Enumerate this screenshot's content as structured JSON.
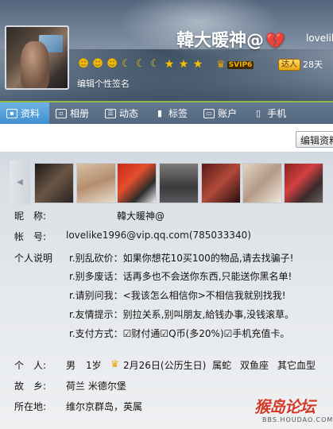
{
  "header": {
    "nickname": "韓大暖神@",
    "account_truncated": "lovelik",
    "vip_label": "SVIP6",
    "daren_label": "达人",
    "daren_days": "28天",
    "signature_edit": "编辑个性签名",
    "level_icons": [
      "sun-icon",
      "sun-icon",
      "sun-icon",
      "moon-icon",
      "moon-icon",
      "moon-icon",
      "star-icon",
      "star-icon",
      "star-icon"
    ],
    "colors": {
      "accent_green": "#8fb84a",
      "tab_active": "#3f8ed0",
      "heart": "#c01818"
    }
  },
  "tabs": [
    {
      "label": "资料",
      "icon": "profile-card-icon",
      "active": true
    },
    {
      "label": "相册",
      "icon": "photo-album-icon",
      "active": false
    },
    {
      "label": "动态",
      "icon": "feed-icon",
      "active": false
    },
    {
      "label": "标签",
      "icon": "bookmark-icon",
      "active": false
    },
    {
      "label": "账户",
      "icon": "wallet-icon",
      "active": false
    },
    {
      "label": "手机",
      "icon": "phone-icon",
      "active": false
    }
  ],
  "toolbar": {
    "edit_label": "编辑资料"
  },
  "profile": {
    "nickname_label": "昵　称:",
    "nickname_value": "韓大暖神@",
    "account_label": "帐　号:",
    "account_value": "lovelike1996@vip.qq.com(785033340)",
    "desc_label": "个人说明",
    "desc_lines": [
      "r.别乱砍价：如果你想花10买100的物品,请去找骗子!",
      "r.别多废话：话再多也不会送你东西,只能送你黑名单!",
      "r.请别问我：<我该怎么相信你>不相信我就别找我!",
      "r.友情提示：别拉关系,别叫朋友,給钱办事,没钱滚草。",
      "r.支付方式：☑财付通☑Q币(多20%)☑手机充值卡。"
    ],
    "personal_label": "个　人:",
    "personal_gender": "男",
    "personal_age": "1岁",
    "personal_birthday": "2月26日(公历生日)",
    "personal_zodiac": "属蛇",
    "personal_sign": "双鱼座",
    "personal_blood": "其它血型",
    "hometown_label": "故　乡:",
    "hometown_value": "荷兰 米德尔堡",
    "location_label": "所在地:",
    "location_value": "维尔京群岛，英属"
  },
  "watermark": {
    "title": "猴岛论坛",
    "url": "BBS.HOUDAO.COM"
  }
}
